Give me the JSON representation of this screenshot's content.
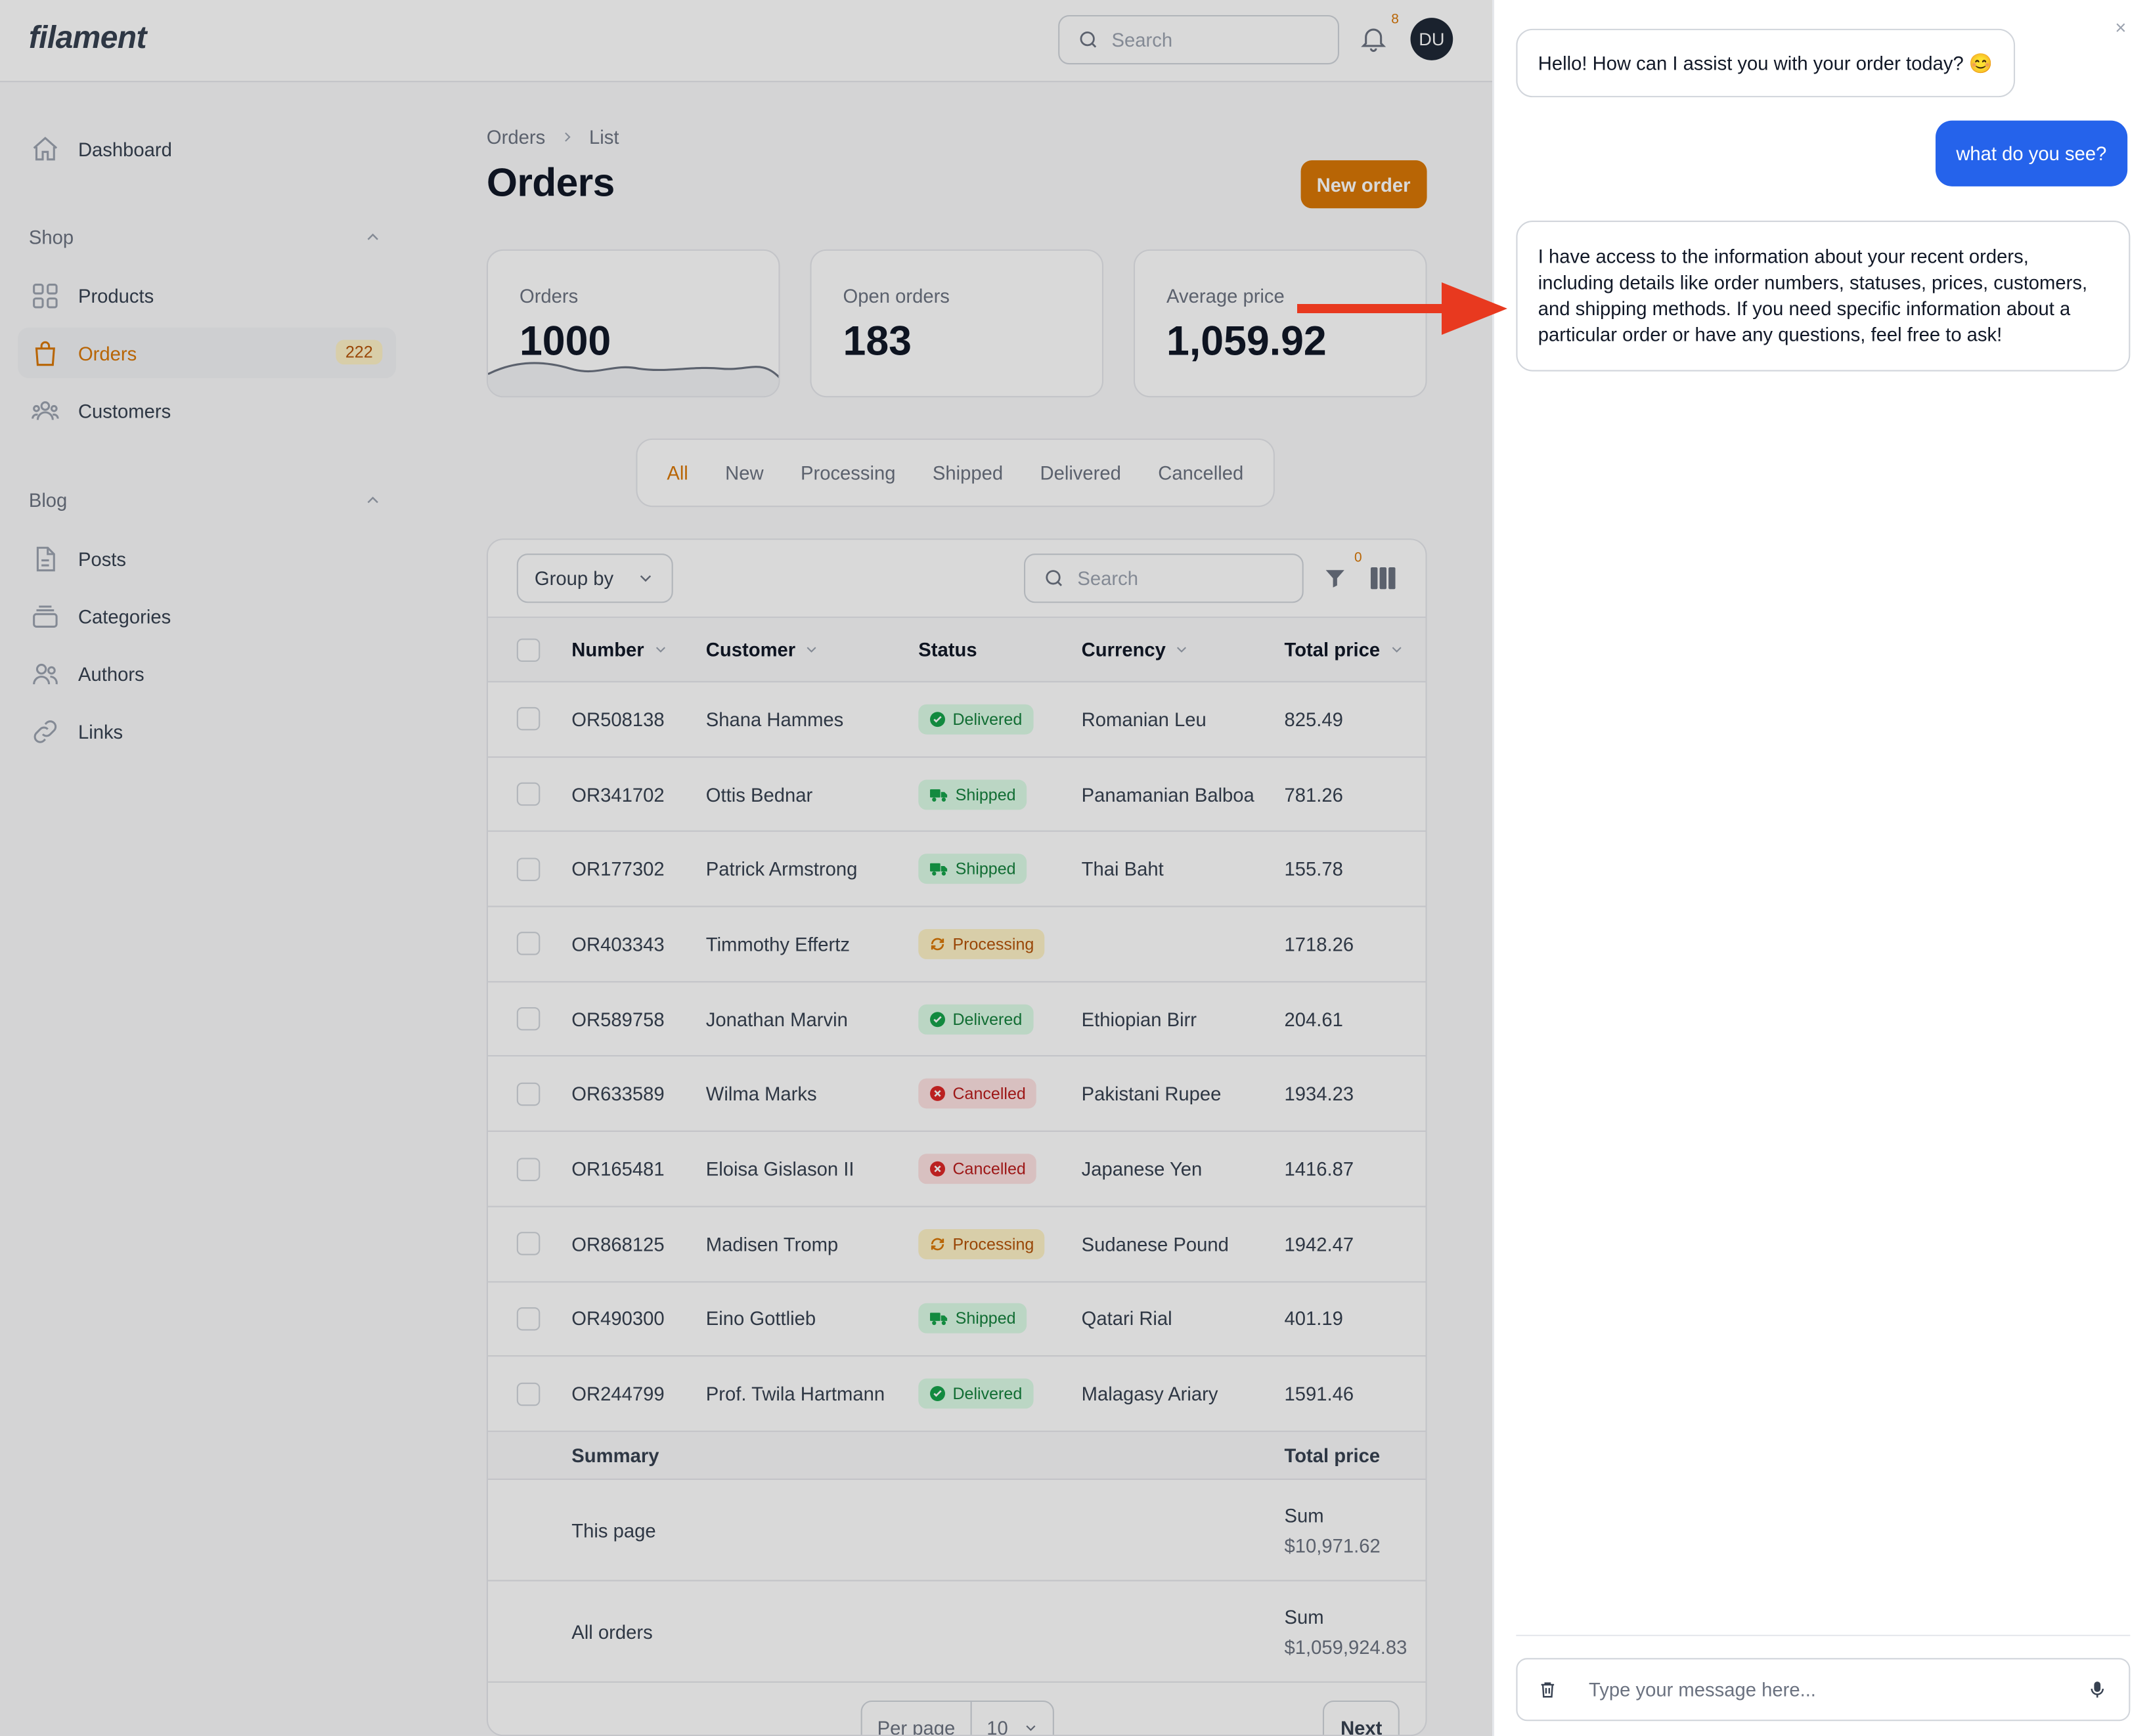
{
  "app": {
    "logo": "filament",
    "search_placeholder": "Search",
    "notifications_count": "8",
    "avatar_initials": "DU"
  },
  "sidebar": {
    "dashboard": "Dashboard",
    "shop_group": "Shop",
    "blog_group": "Blog",
    "items": [
      {
        "label": "Products"
      },
      {
        "label": "Orders",
        "badge": "222"
      },
      {
        "label": "Customers"
      },
      {
        "label": "Posts"
      },
      {
        "label": "Categories"
      },
      {
        "label": "Authors"
      },
      {
        "label": "Links"
      }
    ]
  },
  "page": {
    "breadcrumb": [
      "Orders",
      "List"
    ],
    "title": "Orders",
    "new_order_label": "New order"
  },
  "stats": [
    {
      "label": "Orders",
      "value": "1000"
    },
    {
      "label": "Open orders",
      "value": "183"
    },
    {
      "label": "Average price",
      "value": "1,059.92"
    }
  ],
  "tabs": [
    "All",
    "New",
    "Processing",
    "Shipped",
    "Delivered",
    "Cancelled"
  ],
  "table": {
    "group_by": "Group by",
    "search_placeholder": "Search",
    "filter_count": "0",
    "headers": {
      "number": "Number",
      "customer": "Customer",
      "status": "Status",
      "currency": "Currency",
      "total": "Total price"
    },
    "rows": [
      {
        "number": "OR508138",
        "customer": "Shana Hammes",
        "status": "Delivered",
        "currency": "Romanian Leu",
        "total": "825.49"
      },
      {
        "number": "OR341702",
        "customer": "Ottis Bednar",
        "status": "Shipped",
        "currency": "Panamanian Balboa",
        "total": "781.26"
      },
      {
        "number": "OR177302",
        "customer": "Patrick Armstrong",
        "status": "Shipped",
        "currency": "Thai Baht",
        "total": "155.78"
      },
      {
        "number": "OR403343",
        "customer": "Timmothy Effertz",
        "status": "Processing",
        "currency": "",
        "total": "1718.26"
      },
      {
        "number": "OR589758",
        "customer": "Jonathan Marvin",
        "status": "Delivered",
        "currency": "Ethiopian Birr",
        "total": "204.61"
      },
      {
        "number": "OR633589",
        "customer": "Wilma Marks",
        "status": "Cancelled",
        "currency": "Pakistani Rupee",
        "total": "1934.23"
      },
      {
        "number": "OR165481",
        "customer": "Eloisa Gislason II",
        "status": "Cancelled",
        "currency": "Japanese Yen",
        "total": "1416.87"
      },
      {
        "number": "OR868125",
        "customer": "Madisen Tromp",
        "status": "Processing",
        "currency": "Sudanese Pound",
        "total": "1942.47"
      },
      {
        "number": "OR490300",
        "customer": "Eino Gottlieb",
        "status": "Shipped",
        "currency": "Qatari Rial",
        "total": "401.19"
      },
      {
        "number": "OR244799",
        "customer": "Prof. Twila Hartmann",
        "status": "Delivered",
        "currency": "Malagasy Ariary",
        "total": "1591.46"
      }
    ],
    "summary": {
      "label": "Summary",
      "total_header": "Total price",
      "this_page": "This page",
      "this_page_sum_label": "Sum",
      "this_page_sum": "$10,971.62",
      "all_orders": "All orders",
      "all_orders_sum_label": "Sum",
      "all_orders_sum": "$1,059,924.83"
    },
    "per_page_label": "Per page",
    "per_page_value": "10",
    "next_label": "Next"
  },
  "chat": {
    "messages": [
      {
        "role": "assistant",
        "text": "Hello! How can I assist you with your order today? 😊"
      },
      {
        "role": "user",
        "text": "what do you see?"
      },
      {
        "role": "assistant",
        "text": "I have access to the information about your recent orders, including details like order numbers, statuses, prices, customers, and shipping methods. If you need specific information about a particular order or have any questions, feel free to ask!"
      }
    ],
    "input_placeholder": "Type your message here...",
    "close_glyph": "×"
  },
  "colors": {
    "accent": "#d97706",
    "chat_user": "#2563eb",
    "annotation_arrow": "#e8391f"
  },
  "icons": [
    "search-icon",
    "bell-icon",
    "home-icon",
    "chevron-up-icon",
    "grid-icon",
    "shopping-bag-icon",
    "users-icon",
    "document-icon",
    "stack-icon",
    "user-group-icon",
    "link-icon",
    "funnel-icon",
    "columns-icon",
    "chevron-down-icon",
    "check-circle-icon",
    "truck-icon",
    "refresh-icon",
    "x-circle-icon",
    "trash-icon",
    "microphone-icon",
    "close-icon"
  ]
}
